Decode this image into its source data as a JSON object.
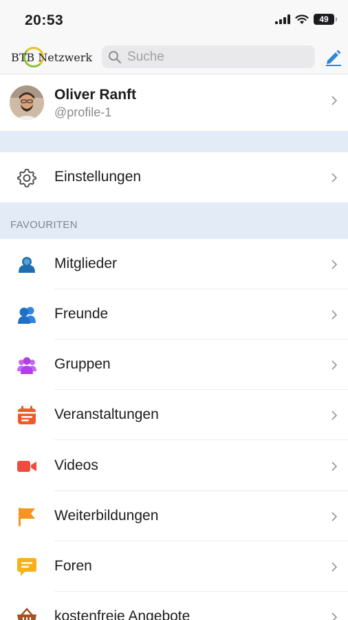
{
  "status_bar": {
    "time": "20:53",
    "battery": "49"
  },
  "header": {
    "logo_text": "BTB Netzwerk",
    "search_placeholder": "Suche"
  },
  "profile": {
    "name": "Oliver Ranft",
    "handle": "@profile-1"
  },
  "settings": {
    "label": "Einstellungen"
  },
  "favourites": {
    "title": "FAVOURITEN",
    "items": [
      {
        "label": "Mitglieder",
        "icon": "members-icon",
        "color": "#1f6fb0"
      },
      {
        "label": "Freunde",
        "icon": "friends-icon",
        "color": "#2f86de"
      },
      {
        "label": "Gruppen",
        "icon": "groups-icon",
        "color": "#b13ee6"
      },
      {
        "label": "Veranstaltungen",
        "icon": "calendar-icon",
        "color": "#f0592a"
      },
      {
        "label": "Videos",
        "icon": "video-icon",
        "color": "#ef4c3f"
      },
      {
        "label": "Weiterbildungen",
        "icon": "flag-icon",
        "color": "#f5941f"
      },
      {
        "label": "Foren",
        "icon": "forum-icon",
        "color": "#f7b21b"
      },
      {
        "label": "kostenfreie Angebote",
        "icon": "basket-icon",
        "color": "#a5541e"
      }
    ]
  },
  "colors": {
    "accent": "#2f86de",
    "section_bg": "#e3ecf6"
  }
}
